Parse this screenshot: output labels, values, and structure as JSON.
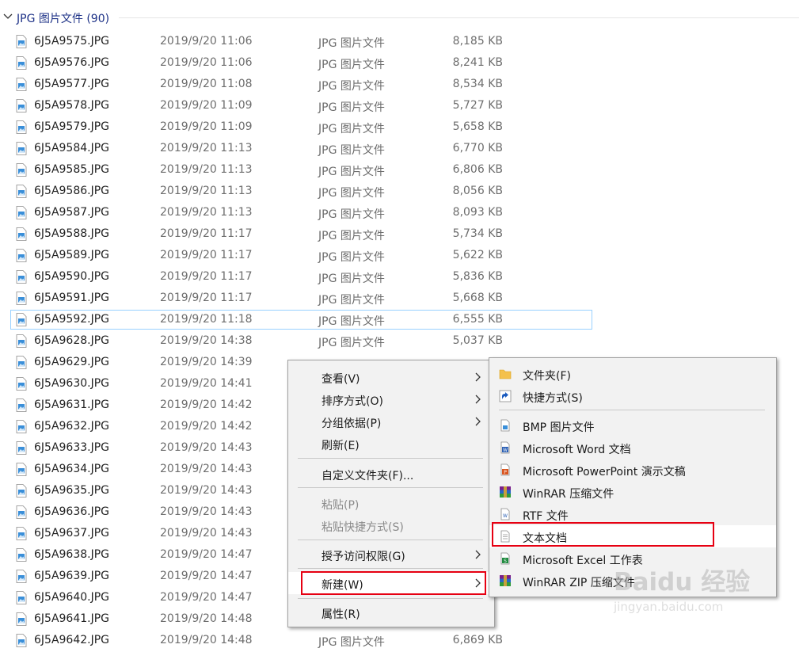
{
  "group": {
    "title": "JPG 图片文件 (90)"
  },
  "files": [
    {
      "name": "6J5A9575.JPG",
      "date": "2019/9/20 11:06",
      "type": "JPG 图片文件",
      "size": "8,185 KB"
    },
    {
      "name": "6J5A9576.JPG",
      "date": "2019/9/20 11:06",
      "type": "JPG 图片文件",
      "size": "8,241 KB"
    },
    {
      "name": "6J5A9577.JPG",
      "date": "2019/9/20 11:08",
      "type": "JPG 图片文件",
      "size": "8,534 KB"
    },
    {
      "name": "6J5A9578.JPG",
      "date": "2019/9/20 11:09",
      "type": "JPG 图片文件",
      "size": "5,727 KB"
    },
    {
      "name": "6J5A9579.JPG",
      "date": "2019/9/20 11:09",
      "type": "JPG 图片文件",
      "size": "5,658 KB"
    },
    {
      "name": "6J5A9584.JPG",
      "date": "2019/9/20 11:13",
      "type": "JPG 图片文件",
      "size": "6,770 KB"
    },
    {
      "name": "6J5A9585.JPG",
      "date": "2019/9/20 11:13",
      "type": "JPG 图片文件",
      "size": "6,806 KB"
    },
    {
      "name": "6J5A9586.JPG",
      "date": "2019/9/20 11:13",
      "type": "JPG 图片文件",
      "size": "8,056 KB"
    },
    {
      "name": "6J5A9587.JPG",
      "date": "2019/9/20 11:13",
      "type": "JPG 图片文件",
      "size": "8,093 KB"
    },
    {
      "name": "6J5A9588.JPG",
      "date": "2019/9/20 11:17",
      "type": "JPG 图片文件",
      "size": "5,734 KB"
    },
    {
      "name": "6J5A9589.JPG",
      "date": "2019/9/20 11:17",
      "type": "JPG 图片文件",
      "size": "5,622 KB"
    },
    {
      "name": "6J5A9590.JPG",
      "date": "2019/9/20 11:17",
      "type": "JPG 图片文件",
      "size": "5,836 KB"
    },
    {
      "name": "6J5A9591.JPG",
      "date": "2019/9/20 11:17",
      "type": "JPG 图片文件",
      "size": "5,668 KB"
    },
    {
      "name": "6J5A9592.JPG",
      "date": "2019/9/20 11:18",
      "type": "JPG 图片文件",
      "size": "6,555 KB",
      "selected": true
    },
    {
      "name": "6J5A9628.JPG",
      "date": "2019/9/20 14:38",
      "type": "JPG 图片文件",
      "size": "5,037 KB"
    },
    {
      "name": "6J5A9629.JPG",
      "date": "2019/9/20 14:39",
      "type": "",
      "size": ""
    },
    {
      "name": "6J5A9630.JPG",
      "date": "2019/9/20 14:41",
      "type": "",
      "size": ""
    },
    {
      "name": "6J5A9631.JPG",
      "date": "2019/9/20 14:42",
      "type": "",
      "size": ""
    },
    {
      "name": "6J5A9632.JPG",
      "date": "2019/9/20 14:42",
      "type": "",
      "size": ""
    },
    {
      "name": "6J5A9633.JPG",
      "date": "2019/9/20 14:43",
      "type": "",
      "size": ""
    },
    {
      "name": "6J5A9634.JPG",
      "date": "2019/9/20 14:43",
      "type": "",
      "size": ""
    },
    {
      "name": "6J5A9635.JPG",
      "date": "2019/9/20 14:43",
      "type": "",
      "size": ""
    },
    {
      "name": "6J5A9636.JPG",
      "date": "2019/9/20 14:43",
      "type": "",
      "size": ""
    },
    {
      "name": "6J5A9637.JPG",
      "date": "2019/9/20 14:43",
      "type": "",
      "size": ""
    },
    {
      "name": "6J5A9638.JPG",
      "date": "2019/9/20 14:47",
      "type": "",
      "size": ""
    },
    {
      "name": "6J5A9639.JPG",
      "date": "2019/9/20 14:47",
      "type": "",
      "size": ""
    },
    {
      "name": "6J5A9640.JPG",
      "date": "2019/9/20 14:47",
      "type": "",
      "size": ""
    },
    {
      "name": "6J5A9641.JPG",
      "date": "2019/9/20 14:48",
      "type": "",
      "size": ""
    },
    {
      "name": "6J5A9642.JPG",
      "date": "2019/9/20 14:48",
      "type": "JPG 图片文件",
      "size": "6,869 KB"
    }
  ],
  "context_menu": {
    "view": "查看(V)",
    "sort_by": "排序方式(O)",
    "group_by": "分组依据(P)",
    "refresh": "刷新(E)",
    "customize_folder": "自定义文件夹(F)...",
    "paste": "粘贴(P)",
    "paste_shortcut": "粘贴快捷方式(S)",
    "give_access": "授予访问权限(G)",
    "new": "新建(W)",
    "properties": "属性(R)"
  },
  "new_submenu": {
    "folder": "文件夹(F)",
    "shortcut": "快捷方式(S)",
    "bmp": "BMP 图片文件",
    "word": "Microsoft Word 文档",
    "powerpoint": "Microsoft PowerPoint 演示文稿",
    "winrar": "WinRAR 压缩文件",
    "rtf": "RTF 文件",
    "text": "文本文档",
    "excel": "Microsoft Excel 工作表",
    "winrar_zip": "WinRAR ZIP 压缩文件"
  },
  "watermark": {
    "logo": "Baidu 经验",
    "url": "jingyan.baidu.com"
  },
  "colors": {
    "highlight_box": "#e60012",
    "selection_border": "#99d1ff",
    "group_title": "#1e3287"
  }
}
